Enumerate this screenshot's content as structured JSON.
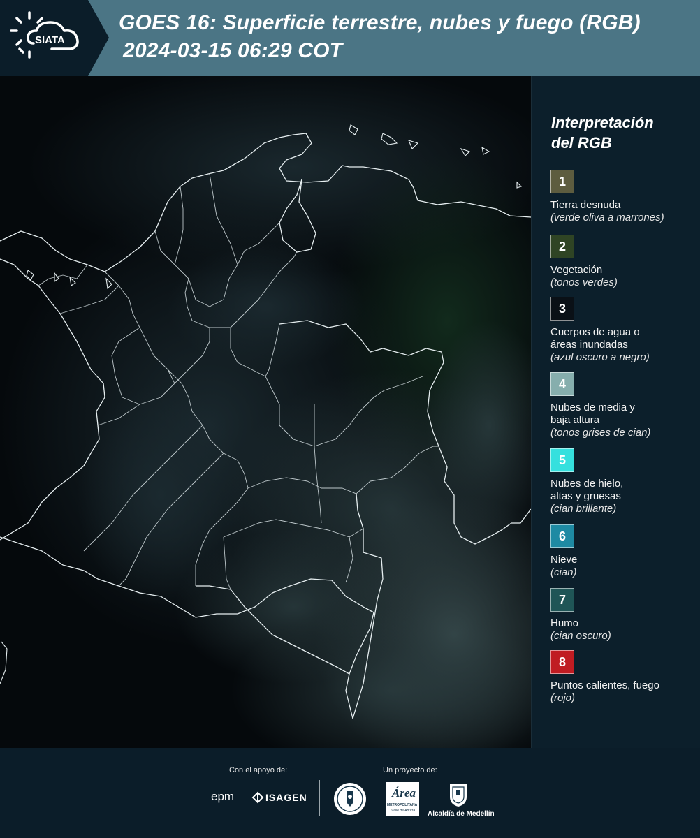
{
  "header": {
    "logo_text": "SIATA",
    "title_line1": "GOES 16: Superficie terrestre, nubes y fuego (RGB)",
    "title_line2": "2024-03-15 06:29 COT"
  },
  "legend": {
    "title_line1": "Interpretación",
    "title_line2": "del RGB",
    "items": [
      {
        "num": "1",
        "color": "#5d5c3f",
        "label": [
          "Tierra desnuda"
        ],
        "sub": [
          "(verde oliva a marrones)"
        ]
      },
      {
        "num": "2",
        "color": "#2f4424",
        "label": [
          "Vegetación"
        ],
        "sub": [
          "(tonos verdes)"
        ]
      },
      {
        "num": "3",
        "color": "#0a1016",
        "label": [
          "Cuerpos de agua o",
          "áreas inundadas"
        ],
        "sub": [
          "(azul oscuro a negro)"
        ]
      },
      {
        "num": "4",
        "color": "#86aead",
        "label": [
          "Nubes de media y",
          "baja altura"
        ],
        "sub": [
          "(tonos grises de cian)"
        ]
      },
      {
        "num": "5",
        "color": "#35e0de",
        "label": [
          "Nubes de hielo,",
          "altas y gruesas"
        ],
        "sub": [
          "(cian brillante)"
        ]
      },
      {
        "num": "6",
        "color": "#1e8aa3",
        "label": [
          "Nieve"
        ],
        "sub": [
          "(cian)"
        ]
      },
      {
        "num": "7",
        "color": "#1f5556",
        "label": [
          "Humo"
        ],
        "sub": [
          "(cian oscuro)"
        ]
      },
      {
        "num": "8",
        "color": "#c01c22",
        "label": [
          "Puntos calientes, fuego"
        ],
        "sub": [
          "(rojo)"
        ]
      }
    ]
  },
  "footer": {
    "support_label": "Con el apoyo de:",
    "project_label": "Un proyecto de:",
    "sponsor_epm": "epm",
    "sponsor_isagen": "ISAGEN",
    "area_metro_name": "Área",
    "area_metro_sub": "METROPOLITANA",
    "area_metro_sub2": "Valle de Aburrá",
    "alcaldia": "Alcaldía de Medellín"
  },
  "colors": {
    "header_band": "#4b7585",
    "background": "#0b1d29",
    "map_bg": "#030608"
  }
}
